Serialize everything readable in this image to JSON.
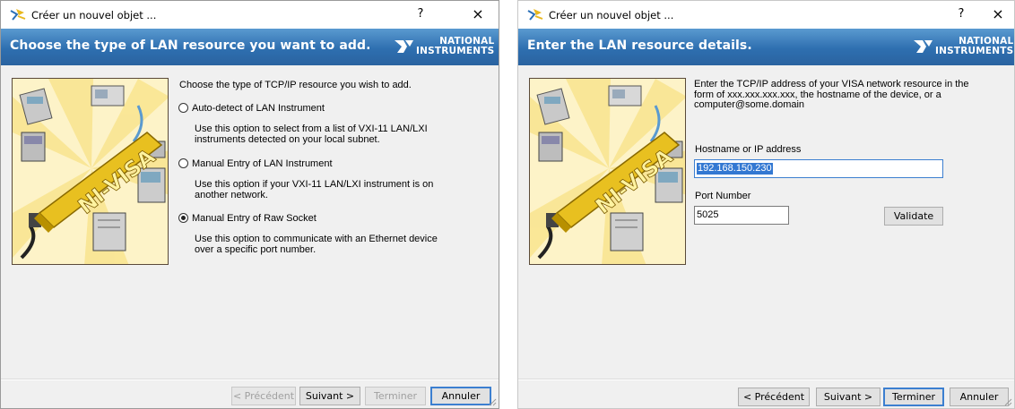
{
  "left": {
    "title": "Créer un nouvel objet ...",
    "help_glyph": "?",
    "close_glyph": "×",
    "banner": "Choose the type of LAN resource you want to add.",
    "logo_line1": "NATIONAL",
    "logo_line2": "INSTRUMENTS",
    "prompt": "Choose the type of TCP/IP resource you wish to add.",
    "options": [
      {
        "label": "Auto-detect of LAN Instrument",
        "desc1": "Use this option to select from a list of VXI-11 LAN/LXI",
        "desc2": "instruments detected on your local subnet.",
        "selected": false
      },
      {
        "label": "Manual Entry of LAN Instrument",
        "desc1": "Use this option if your VXI-11 LAN/LXI instrument is on",
        "desc2": "another network.",
        "selected": false
      },
      {
        "label": "Manual Entry of Raw Socket",
        "desc1": "Use this option to communicate with an Ethernet device",
        "desc2": "over a specific port number.",
        "selected": true
      }
    ],
    "buttons": {
      "prev": "< Précédent",
      "next": "Suivant >",
      "finish": "Terminer",
      "cancel": "Annuler"
    }
  },
  "right": {
    "title": "Créer un nouvel objet ...",
    "help_glyph": "?",
    "close_glyph": "×",
    "banner": "Enter the LAN resource details.",
    "logo_line1": "NATIONAL",
    "logo_line2": "INSTRUMENTS",
    "intro1": "Enter the TCP/IP address of your VISA network resource in the",
    "intro2": "form of xxx.xxx.xxx.xxx, the hostname of the device, or a",
    "intro3": "computer@some.domain",
    "host_label": "Hostname or IP address",
    "host_value": "192.168.150.230",
    "port_label": "Port Number",
    "port_value": "5025",
    "validate": "Validate",
    "buttons": {
      "prev": "< Précédent",
      "next": "Suivant >",
      "finish": "Terminer",
      "cancel": "Annuler"
    }
  },
  "art_text": "NI-VISA",
  "colors": {
    "banner": "#2e6fb0",
    "accent": "#3c7fd0",
    "art_bg": "#fdf3c8",
    "bar_gold": "#e8c020"
  }
}
